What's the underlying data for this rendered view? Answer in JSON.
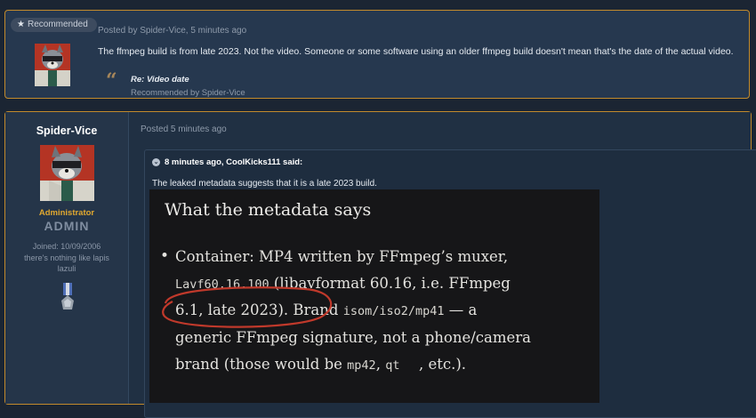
{
  "recommended_post": {
    "badge_label": "Recommended",
    "meta": "Posted by Spider-Vice, 5 minutes ago",
    "text": "The ffmpeg build is from late 2023. Not the video. Someone or some software using an older ffmpeg build doesn't mean that's the date of the actual video.",
    "link_title": "Re: Video date",
    "recommended_by": "Recommended by Spider-Vice"
  },
  "post": {
    "author": {
      "username": "Spider-Vice",
      "role": "Administrator",
      "role_badge": "ADMIN",
      "joined": "Joined: 10/09/2006",
      "bio_line1": "there's nothing like lapis",
      "bio_line2": "lazuli"
    },
    "posted": "Posted 5 minutes ago",
    "quote": {
      "header": "8 minutes ago, CoolKicks111 said:",
      "text": "The leaked metadata suggests that it is a late 2023 build."
    },
    "screenshot": {
      "heading": "What the metadata says",
      "bullet": "•",
      "line1": "Container: MP4 written by FFmpeg’s muxer,",
      "line2_code": "Lavf60.16.100",
      "line2_rest": " (libavformat 60.16, i.e. FFmpeg",
      "line3_text": "6.1, late 2023). Brand ",
      "line3_code": "isom/iso2/mp41",
      "line3_rest": " — a",
      "line4": "generic FFmpeg signature, not a phone/camera",
      "line5_text": "brand (those would be ",
      "line5_code1": "mp42",
      "line5_sep": ", ",
      "line5_code2": "qt  ",
      "line5_rest": " , etc.)."
    }
  },
  "colors": {
    "accent_border": "#c28a2c",
    "role_color": "#e0a830",
    "annotation_red": "#c0392b"
  }
}
